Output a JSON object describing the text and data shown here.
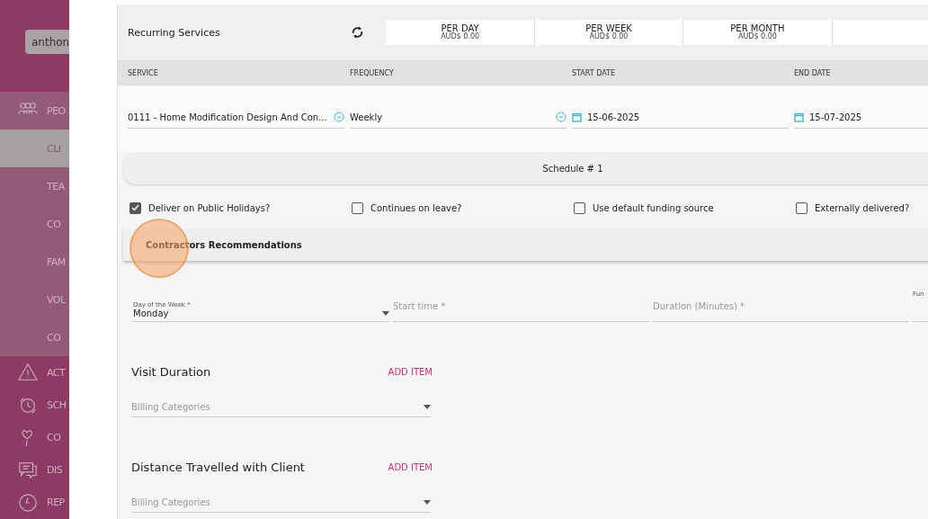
{
  "sidebar": {
    "user_field": "anthon",
    "items": [
      {
        "label": "PEO",
        "kind": "section",
        "selected": false
      },
      {
        "label": "CLI",
        "kind": "sub",
        "selected": true
      },
      {
        "label": "TEA",
        "kind": "sub",
        "selected": false
      },
      {
        "label": "CO",
        "kind": "sub",
        "selected": false
      },
      {
        "label": "FAM",
        "kind": "sub",
        "selected": false
      },
      {
        "label": "VOL",
        "kind": "sub",
        "selected": false
      },
      {
        "label": "CO",
        "kind": "sub",
        "selected": false
      },
      {
        "label": "ACT",
        "kind": "main",
        "selected": false
      },
      {
        "label": "SCH",
        "kind": "main",
        "selected": false
      },
      {
        "label": "CO",
        "kind": "main",
        "selected": false
      },
      {
        "label": "DIS",
        "kind": "main",
        "selected": false
      },
      {
        "label": "REP",
        "kind": "main",
        "selected": false
      }
    ]
  },
  "panel": {
    "title": "Recurring Services",
    "totals": [
      {
        "label": "PER DAY",
        "value": "AUD$ 0.00"
      },
      {
        "label": "PER WEEK",
        "value": "AUD$ 0.00"
      },
      {
        "label": "PER MONTH",
        "value": "AUD$ 0.00"
      }
    ],
    "columns": [
      "SERVICE",
      "FREQUENCY",
      "START DATE",
      "END DATE"
    ],
    "row": [
      {
        "kind": "select",
        "value": "0111 - Home Modification Design And Con..."
      },
      {
        "kind": "select",
        "value": "Weekly"
      },
      {
        "kind": "date",
        "value": "15-06-2025"
      },
      {
        "kind": "date",
        "value": "15-07-2025"
      }
    ],
    "schedule_title": "Schedule # 1",
    "options": [
      {
        "label": "Deliver on Public Holidays?",
        "checked": true
      },
      {
        "label": "Continues on leave?",
        "checked": false
      },
      {
        "label": "Use default funding source",
        "checked": false
      },
      {
        "label": "Externally delivered?",
        "checked": false
      }
    ],
    "contractors_title": "Contractors Recommendations",
    "fields": [
      {
        "kind": "select",
        "label": "Day of the Week *",
        "value": "Monday"
      },
      {
        "kind": "text",
        "placeholder": "Start time *"
      },
      {
        "kind": "text",
        "placeholder": "Duration (Minutes) *"
      },
      {
        "kind": "text",
        "label": "Fun"
      }
    ],
    "sections": [
      {
        "title": "Visit Duration",
        "action": "ADD ITEM",
        "select_placeholder": "Billing Categories"
      },
      {
        "title": "Distance Travelled with Client",
        "action": "ADD ITEM",
        "select_placeholder": "Billing Categories"
      }
    ]
  }
}
